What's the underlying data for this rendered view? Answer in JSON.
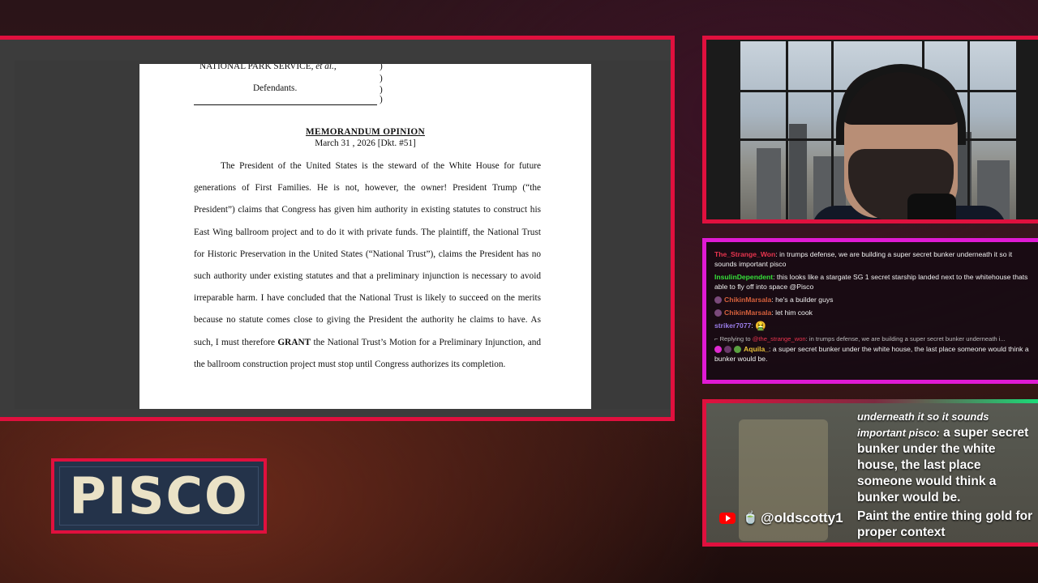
{
  "document": {
    "caption_line": "NATIONAL PARK SERVICE, et al.,",
    "defendants": "Defendants.",
    "parens": [
      ")",
      ")",
      ")"
    ],
    "title": "MEMORANDUM OPINION",
    "date": "March 31 , 2026 [Dkt. #51]",
    "body": "The President of the United States is the steward of the White House for future generations of First Families.  He is not, however, the owner!  President Trump (“the President”) claims that Congress has given him authority in existing statutes to construct his East Wing ballroom project and to do it with private funds.  The plaintiff, the National Trust for Historic Preservation in the United States (“National Trust”), claims the President has no such authority under existing statutes and that a preliminary injunction is necessary to avoid irreparable harm.  I have concluded that the National Trust is likely to succeed on the merits because no statute comes close to giving the President the authority he claims to have.  As such, I must therefore",
    "body_bold": "GRANT",
    "body_end": "the National Trust’s Motion for a Preliminary Injunction, and the ballroom construction project must stop until Congress authorizes its completion."
  },
  "chat": {
    "messages": [
      {
        "user": "The_Strange_Won",
        "color": "#e8344e",
        "text": "in trumps defense, we are building a super secret bunker underneath it so it sounds important pisco"
      },
      {
        "user": "InsulinDependent",
        "color": "#36e03a",
        "text": "this looks like a stargate SG 1 secret starship landed next to the whitehouse thats able to fly off into space @Pisco"
      },
      {
        "user": "ChikinMarsala",
        "color": "#d6603c",
        "text": "he's a builder guys"
      },
      {
        "user": "ChikinMarsala",
        "color": "#d6603c",
        "text": "let him cook"
      },
      {
        "user": "striker7077",
        "color": "#9a7ce8",
        "text": "🤮"
      }
    ],
    "reply": {
      "prefix": "Replying to",
      "mention": "@the_strange_won",
      "quote": "in trumps defense, we are building a super secret bunker underneath i...",
      "user": "Aquila_",
      "color": "#e8c23a",
      "text": "a super secret bunker under the white house, the last place someone would think a bunker would be."
    }
  },
  "overlay": {
    "prev_italic": "underneath it so it sounds important pisco:",
    "prev_text": "a super secret bunker under the white house, the last place someone would think a bunker would be.",
    "platform_icon": "youtube-icon",
    "user": "@oldscotty1",
    "message": "Paint the entire thing gold for proper context"
  },
  "logo": {
    "text": "PISCO"
  }
}
